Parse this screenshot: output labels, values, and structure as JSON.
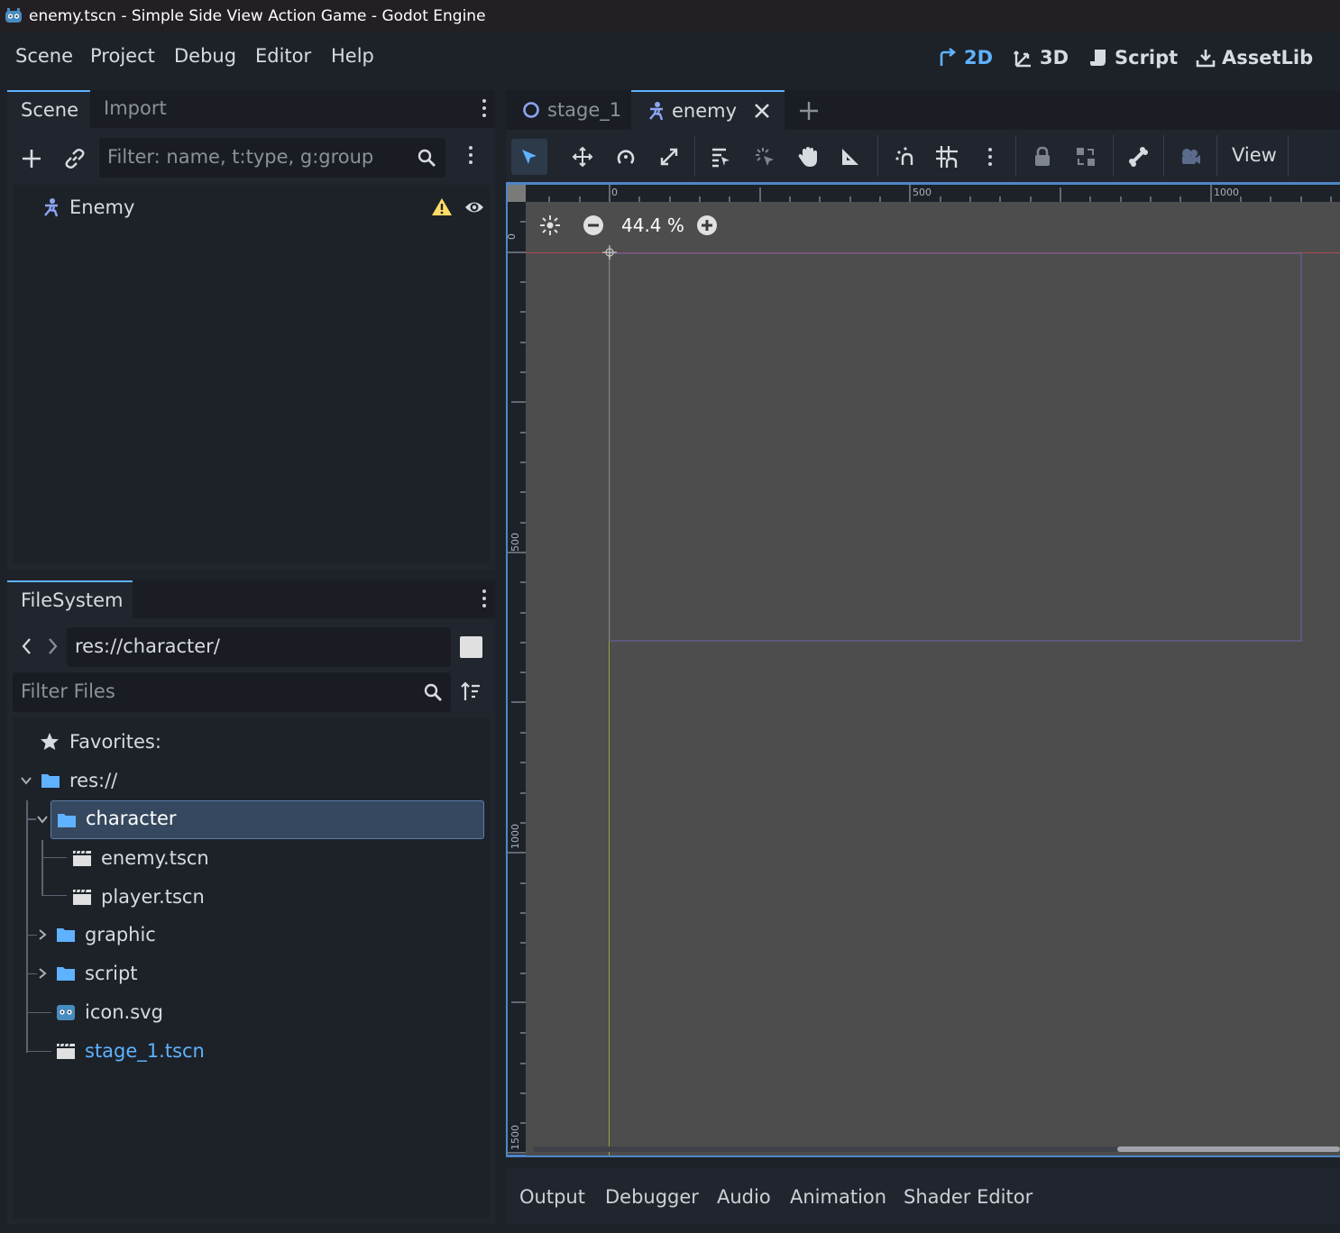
{
  "window": {
    "title": "enemy.tscn - Simple Side View Action Game - Godot Engine"
  },
  "menu": {
    "items": [
      "Scene",
      "Project",
      "Debug",
      "Editor",
      "Help"
    ]
  },
  "workspaces": {
    "items": [
      "2D",
      "3D",
      "Script",
      "AssetLib"
    ],
    "active": "2D",
    "active_color": "#5fb2ff"
  },
  "scene_dock": {
    "tabs": [
      "Scene",
      "Import"
    ],
    "active_tab": "Scene",
    "filter_placeholder": "Filter: name, t:type, g:group",
    "nodes": [
      {
        "name": "Enemy",
        "icon": "character-body-icon",
        "warning": true,
        "visible": true
      }
    ]
  },
  "filesystem_dock": {
    "tab": "FileSystem",
    "path": "res://character/",
    "filter_placeholder": "Filter Files",
    "favorites_label": "Favorites:",
    "tree": {
      "root": "res://",
      "selected_folder": "character",
      "character_children": [
        "enemy.tscn",
        "player.tscn"
      ],
      "other_folders": [
        "graphic",
        "script"
      ],
      "files": [
        "icon.svg",
        "stage_1.tscn"
      ],
      "open_scene_file": "stage_1.tscn"
    }
  },
  "editor_tabs": {
    "items": [
      "stage_1",
      "enemy"
    ],
    "active": "enemy"
  },
  "toolbar": {
    "view_label": "View"
  },
  "viewport": {
    "zoom": "44.4 %",
    "ruler_h_labels": [
      "0",
      "500",
      "1000"
    ],
    "ruler_v_labels": [
      "0",
      "500",
      "1000",
      "1500"
    ],
    "background_color": "#4d4d4d"
  },
  "bottom_panel": {
    "tabs": [
      "Output",
      "Debugger",
      "Audio",
      "Animation",
      "Shader Editor"
    ]
  }
}
